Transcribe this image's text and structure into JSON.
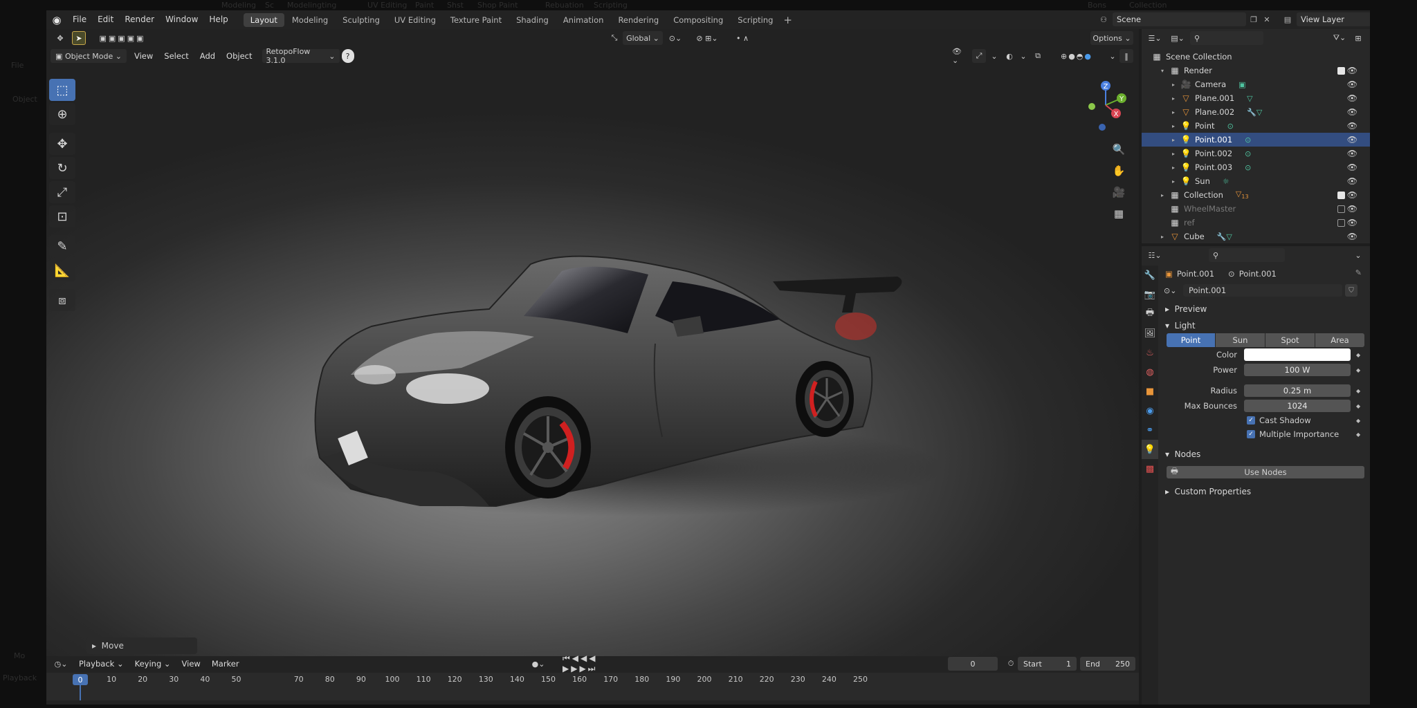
{
  "ghost": {
    "left_items": [
      "File",
      "Object"
    ],
    "tabs": [
      "Modeling",
      "Sc",
      "Modelingting",
      "UV Editing",
      "Paint",
      "Shst",
      "Shop Paint",
      "Rebuation",
      "Scripting"
    ],
    "right_items": [
      "Collection",
      "Bons"
    ],
    "bottom_left": [
      "Mo",
      "Playback"
    ]
  },
  "topbar": {
    "menus": [
      "File",
      "Edit",
      "Render",
      "Window",
      "Help"
    ],
    "tabs": [
      "Layout",
      "Modeling",
      "Sculpting",
      "UV Editing",
      "Texture Paint",
      "Shading",
      "Animation",
      "Rendering",
      "Compositing",
      "Scripting"
    ],
    "active_tab": "Layout",
    "scene": "Scene",
    "view_layer": "View Layer"
  },
  "viewport": {
    "orientation": "Global",
    "options_label": "Options",
    "mode": "Object Mode",
    "menus": [
      "View",
      "Select",
      "Add",
      "Object"
    ],
    "addon": "RetopoFlow 3.1.0",
    "last_op": "Move",
    "gizmo": {
      "x": "X",
      "y": "Y",
      "z": "Z"
    }
  },
  "timeline": {
    "menus": [
      "Playback",
      "Keying",
      "View",
      "Marker"
    ],
    "current_frame": "0",
    "start_label": "Start",
    "start": "1",
    "end_label": "End",
    "end": "250",
    "ticks": [
      "0",
      "10",
      "20",
      "30",
      "40",
      "50",
      "70",
      "80",
      "90",
      "100",
      "110",
      "120",
      "130",
      "140",
      "150",
      "160",
      "170",
      "180",
      "190",
      "200",
      "210",
      "220",
      "230",
      "240",
      "250"
    ]
  },
  "outliner": {
    "root": "Scene Collection",
    "rows": [
      {
        "label": "Render",
        "icon": "collection-icon",
        "depth": 1
      },
      {
        "label": "Camera",
        "icon": "camera-icon",
        "depth": 2
      },
      {
        "label": "Plane.001",
        "icon": "mesh-icon",
        "depth": 2
      },
      {
        "label": "Plane.002",
        "icon": "mesh-icon",
        "depth": 2
      },
      {
        "label": "Point",
        "icon": "light-icon",
        "depth": 2
      },
      {
        "label": "Point.001",
        "icon": "light-icon",
        "depth": 2,
        "selected": true
      },
      {
        "label": "Point.002",
        "icon": "light-icon",
        "depth": 2
      },
      {
        "label": "Point.003",
        "icon": "light-icon",
        "depth": 2
      },
      {
        "label": "Sun",
        "icon": "light-icon",
        "depth": 2
      },
      {
        "label": "Collection",
        "icon": "collection-icon",
        "depth": 1
      },
      {
        "label": "WheelMaster",
        "icon": "collection-icon",
        "depth": 1,
        "dim": true
      },
      {
        "label": "ref",
        "icon": "collection-icon",
        "depth": 1,
        "dim": true
      },
      {
        "label": "Cube",
        "icon": "mesh-icon",
        "depth": 1
      }
    ],
    "collection_badge": "13"
  },
  "properties": {
    "object_name": "Point.001",
    "data_name": "Point.001",
    "light_data": "Point.001",
    "sections": {
      "preview": "Preview",
      "light": "Light",
      "nodes": "Nodes",
      "custom": "Custom Properties"
    },
    "light_types": [
      "Point",
      "Sun",
      "Spot",
      "Area"
    ],
    "active_light_type": "Point",
    "color_label": "Color",
    "power_label": "Power",
    "power": "100 W",
    "radius_label": "Radius",
    "radius": "0.25 m",
    "bounces_label": "Max Bounces",
    "bounces": "1024",
    "cast_shadow": "Cast Shadow",
    "multiple_importance": "Multiple Importance",
    "use_nodes": "Use Nodes"
  },
  "colors": {
    "accent": "#4772b3",
    "selected_row": "#334d80",
    "light_icon": "#e8953a",
    "mesh_icon": "#e8953a",
    "data_icon": "#4fc4a0"
  }
}
